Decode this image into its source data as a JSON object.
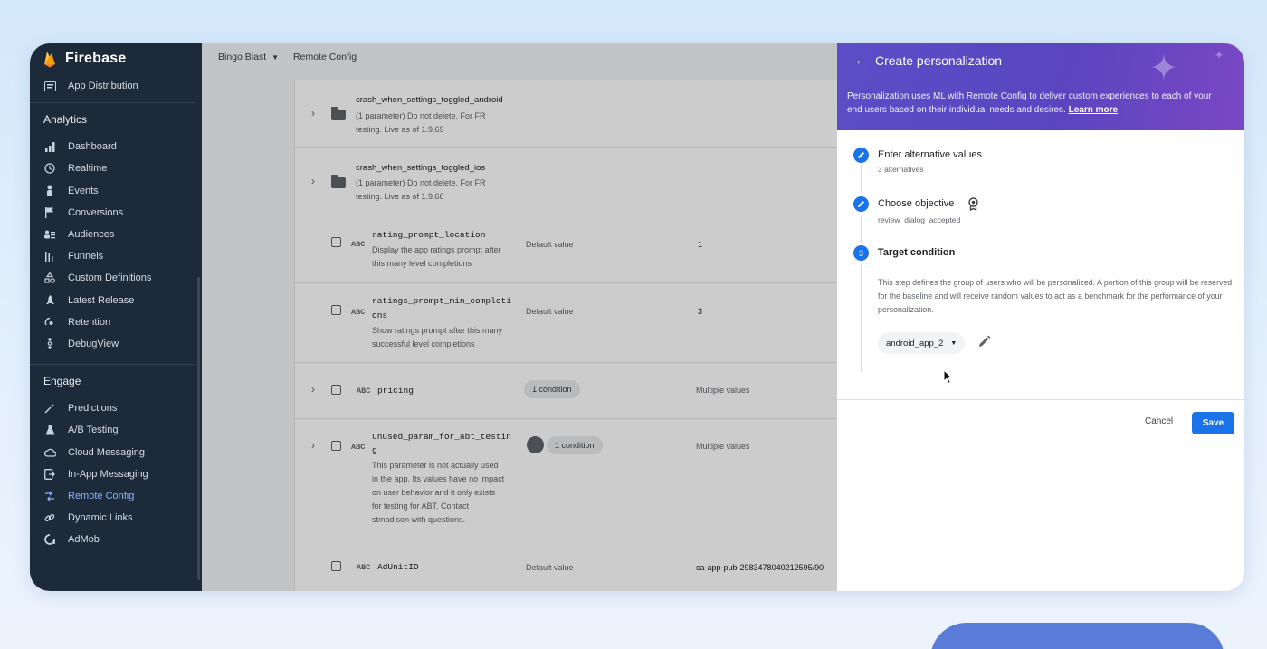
{
  "brand": {
    "name": "Firebase"
  },
  "sidebar": {
    "top_items": [
      {
        "label": "App Distribution",
        "icon": "app-distribution-icon"
      }
    ],
    "analytics_heading": "Analytics",
    "analytics_items": [
      {
        "label": "Dashboard",
        "icon": "bar-chart-icon"
      },
      {
        "label": "Realtime",
        "icon": "clock-icon"
      },
      {
        "label": "Events",
        "icon": "events-icon"
      },
      {
        "label": "Conversions",
        "icon": "flag-icon"
      },
      {
        "label": "Audiences",
        "icon": "audiences-icon"
      },
      {
        "label": "Funnels",
        "icon": "funnel-icon"
      },
      {
        "label": "Custom Definitions",
        "icon": "custom-definitions-icon"
      },
      {
        "label": "Latest Release",
        "icon": "rocket-icon"
      },
      {
        "label": "Retention",
        "icon": "retention-icon"
      },
      {
        "label": "DebugView",
        "icon": "debug-icon"
      }
    ],
    "engage_heading": "Engage",
    "engage_items": [
      {
        "label": "Predictions",
        "icon": "predictions-icon"
      },
      {
        "label": "A/B Testing",
        "icon": "flask-icon"
      },
      {
        "label": "Cloud Messaging",
        "icon": "cloud-icon"
      },
      {
        "label": "In-App Messaging",
        "icon": "in-app-messaging-icon"
      },
      {
        "label": "Remote Config",
        "icon": "remote-config-icon",
        "active": true
      },
      {
        "label": "Dynamic Links",
        "icon": "link-icon"
      },
      {
        "label": "AdMob",
        "icon": "admob-icon"
      }
    ]
  },
  "topbar": {
    "project": "Bingo Blast",
    "section": "Remote Config"
  },
  "params": {
    "group1": {
      "name": "crash_when_settings_toggled_android",
      "desc1": "(1 parameter) Do not delete. For FR",
      "desc2": "testing. Live as of 1.9.69"
    },
    "group2": {
      "name": "crash_when_settings_toggled_ios",
      "desc1": "(1 parameter) Do not delete. For FR",
      "desc2": "testing. Live as of 1.9.66"
    },
    "p1": {
      "type": "ABC",
      "name": "rating_prompt_location",
      "desc1": "Display the app ratings prompt after",
      "desc2": "this many level completions",
      "default_label": "Default value",
      "value": "1"
    },
    "p2": {
      "type": "ABC",
      "name1": "ratings_prompt_min_completi",
      "name2": "ons",
      "desc1": "Show ratings prompt after this many",
      "desc2": "successful level completions",
      "default_label": "Default value",
      "value": "3"
    },
    "p3": {
      "type": "ABC",
      "name": "pricing",
      "condition": "1 condition",
      "value": "Multiple values"
    },
    "p4": {
      "type": "ABC",
      "name1": "unused_param_for_abt_testin",
      "name2": "g",
      "desc1": "This parameter is not actually used",
      "desc2": "in the app. Its values have no impact",
      "desc3": "on user behavior and it only exists",
      "desc4": "for testing for ABT. Contact",
      "desc5": "stmadison with questions.",
      "condition": "1 condition",
      "value": "Multiple values"
    },
    "p5": {
      "type": "ABC",
      "name": "AdUnitID",
      "default_label": "Default value",
      "value": "ca-app-pub-2983478040212595/90"
    }
  },
  "panel": {
    "title": "Create personalization",
    "intro": "Personalization uses ML with Remote Config to deliver custom experiences to each of your end users based on their individual needs and desires.",
    "learn_more": "Learn more",
    "step1": {
      "title": "Enter alternative values",
      "sub": "3 alternatives"
    },
    "step2": {
      "title": "Choose objective",
      "sub": "review_dialog_accepted"
    },
    "step3": {
      "num": "3",
      "title": "Target condition",
      "desc": "This step defines the group of users who will be personalized. A portion of this group will be reserved for the baseline and will receive random values to act as a benchmark for the performance of your personalization."
    },
    "condition_select": "android_app_2",
    "cancel": "Cancel",
    "save": "Save"
  },
  "colors": {
    "accent": "#1a73e8",
    "sidebar": "#1d2a3a",
    "header_start": "#5b4ec7",
    "header_end": "#7b47c4"
  }
}
